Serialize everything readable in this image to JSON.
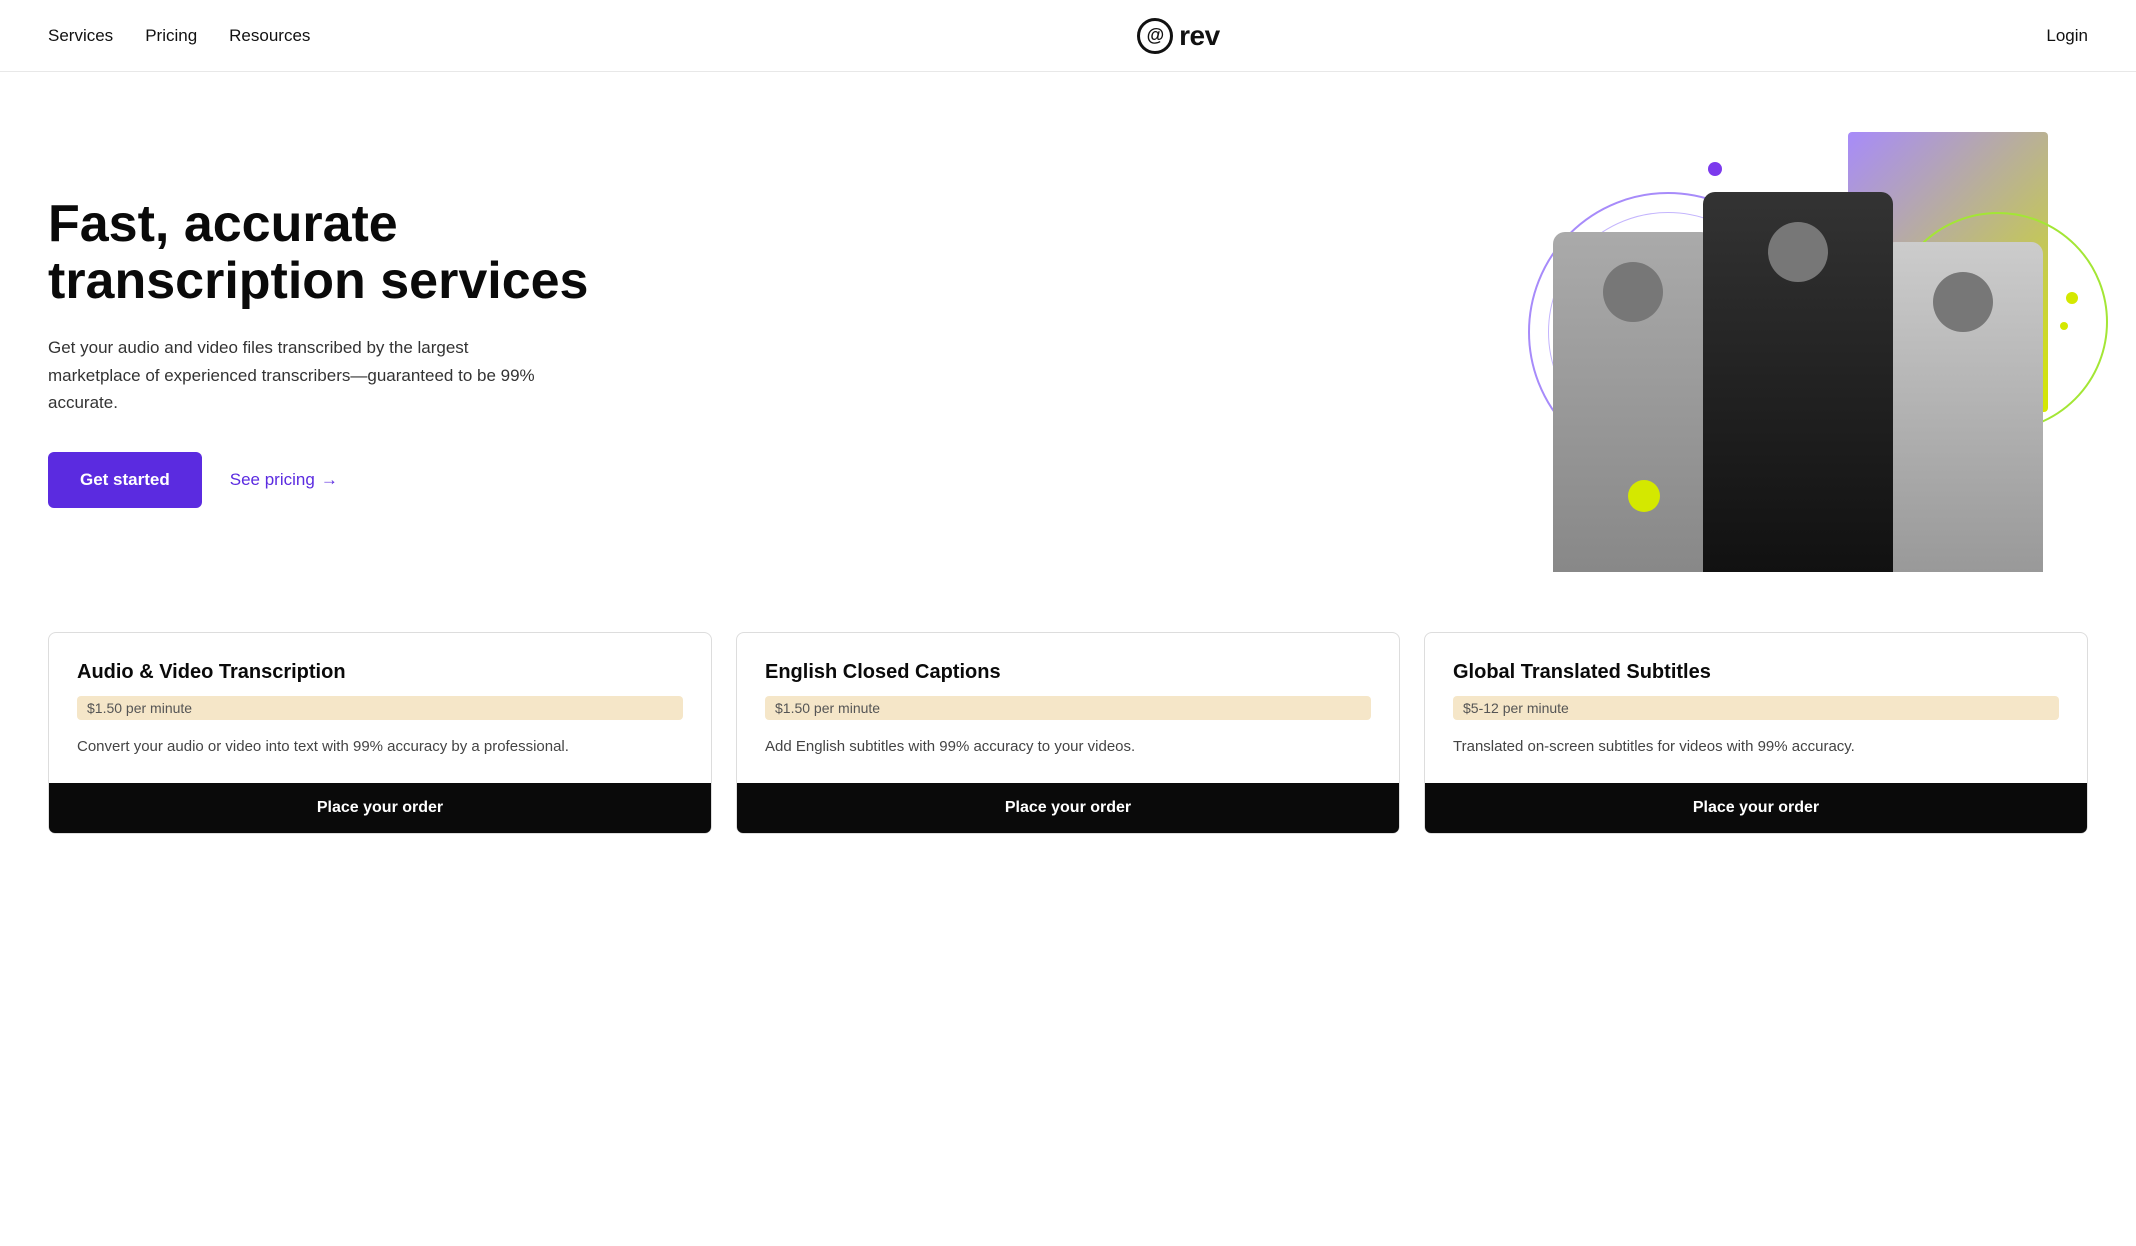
{
  "header": {
    "nav": [
      {
        "label": "Services",
        "id": "services"
      },
      {
        "label": "Pricing",
        "id": "pricing"
      },
      {
        "label": "Resources",
        "id": "resources"
      }
    ],
    "logo_text": "rev",
    "login_label": "Login"
  },
  "hero": {
    "headline": "Fast, accurate transcription services",
    "subtext": "Get your audio and video files transcribed by the largest marketplace of experienced transcribers—guaranteed to be 99% accurate.",
    "cta_primary": "Get started",
    "cta_secondary": "See pricing",
    "cta_arrow": "→"
  },
  "cards": [
    {
      "title": "Audio & Video Transcription",
      "price": "$1.50 per minute",
      "description": "Convert your audio or video into text with 99% accuracy by a professional.",
      "cta": "Place your order"
    },
    {
      "title": "English Closed Captions",
      "price": "$1.50 per minute",
      "description": "Add English subtitles with 99% accuracy to your videos.",
      "cta": "Place your order"
    },
    {
      "title": "Global Translated Subtitles",
      "price": "$5-12 per minute",
      "description": "Translated on-screen subtitles for videos with 99% accuracy.",
      "cta": "Place your order"
    }
  ]
}
